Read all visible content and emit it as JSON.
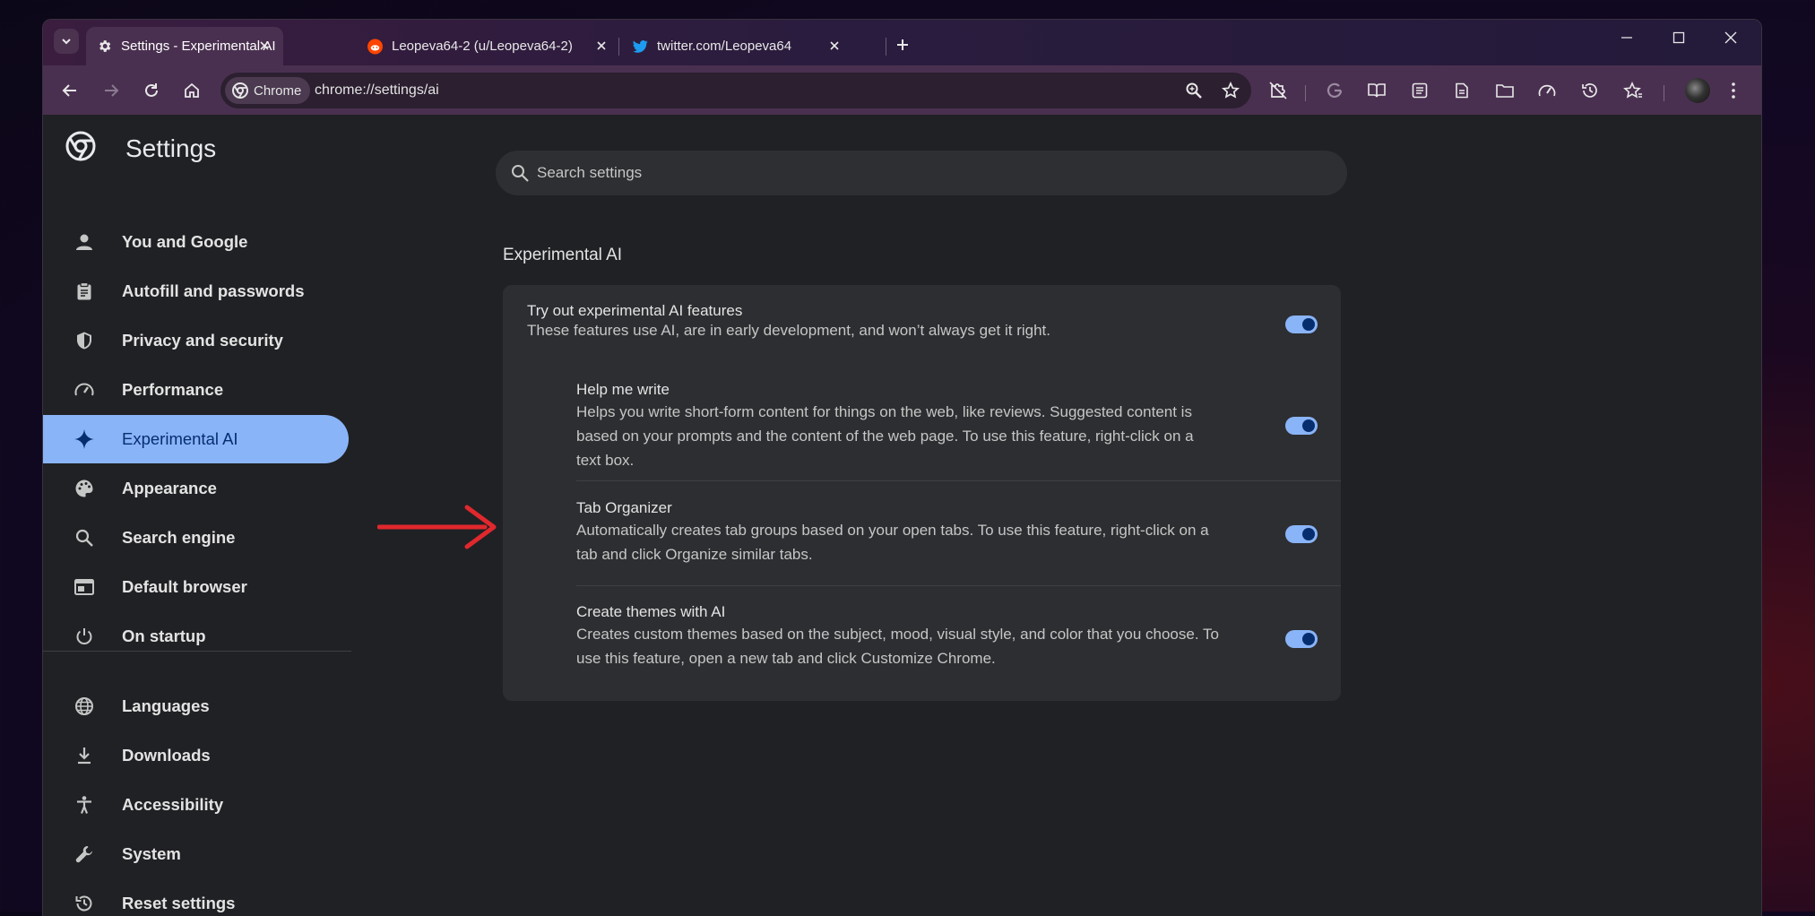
{
  "tabs": [
    {
      "title": "Settings - Experimental AI",
      "icon": "gear-icon",
      "active": true
    },
    {
      "title": "Leopeva64-2 (u/Leopeva64-2)",
      "icon": "reddit-icon",
      "active": false
    },
    {
      "title": "twitter.com/Leopeva64",
      "icon": "twitter-icon",
      "active": false
    }
  ],
  "toolbar": {
    "site_chip": "Chrome",
    "url": "chrome://settings/ai"
  },
  "settings": {
    "title": "Settings",
    "search_placeholder": "Search settings",
    "nav": [
      {
        "label": "You and Google",
        "icon": "person-icon"
      },
      {
        "label": "Autofill and passwords",
        "icon": "clipboard-icon"
      },
      {
        "label": "Privacy and security",
        "icon": "shield-icon"
      },
      {
        "label": "Performance",
        "icon": "speedometer-icon"
      },
      {
        "label": "Experimental AI",
        "icon": "sparkle-icon",
        "selected": true
      },
      {
        "label": "Appearance",
        "icon": "palette-icon"
      },
      {
        "label": "Search engine",
        "icon": "search-icon"
      },
      {
        "label": "Default browser",
        "icon": "browser-window-icon"
      },
      {
        "label": "On startup",
        "icon": "power-icon"
      },
      {
        "label": "Languages",
        "icon": "globe-icon"
      },
      {
        "label": "Downloads",
        "icon": "download-icon"
      },
      {
        "label": "Accessibility",
        "icon": "accessibility-icon"
      },
      {
        "label": "System",
        "icon": "wrench-icon"
      },
      {
        "label": "Reset settings",
        "icon": "history-icon"
      }
    ],
    "section_title": "Experimental AI",
    "main_toggle": {
      "title": "Try out experimental AI features",
      "desc": "These features use AI, are in early development, and won’t always get it right.",
      "on": true
    },
    "features": [
      {
        "title": "Help me write",
        "desc_lines": [
          "Helps you write short-form content for things on the web, like reviews. Suggested content is",
          "based on your prompts and the content of the web page. To use this feature, right-click on a",
          "text box."
        ],
        "on": true
      },
      {
        "title": "Tab Organizer",
        "desc_lines": [
          "Automatically creates tab groups based on your open tabs. To use this feature, right-click on a",
          "tab and click Organize similar tabs."
        ],
        "on": true
      },
      {
        "title": "Create themes with AI",
        "desc_lines": [
          "Creates custom themes based on the subject, mood, visual style, and color that you choose. To",
          "use this feature, open a new tab and click Customize Chrome."
        ],
        "on": true
      }
    ]
  },
  "colors": {
    "accent": "#8ab4f8",
    "toggle_knob": "#062e6f",
    "annotation_arrow": "#e0282d",
    "frame": "#4a3050"
  }
}
